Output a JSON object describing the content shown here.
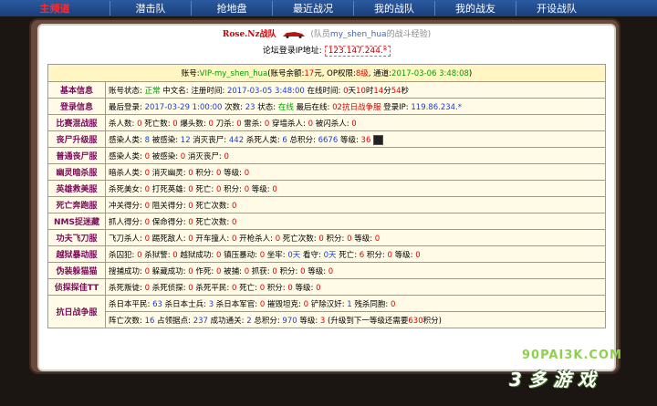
{
  "nav": {
    "brand": "主频道",
    "items": [
      "潜击队",
      "抢地盘",
      "最近战况",
      "我的战队",
      "我的战友",
      "开设战队"
    ]
  },
  "header": {
    "team_name": "Rose.Nz",
    "team_suffix": "战队",
    "member_prefix": "(队员",
    "member_name": "my_shen_hua",
    "member_suffix": "的战斗经验)",
    "forum_ip_label": "论坛登录IP地址:",
    "forum_ip_value": "123.147.244.*"
  },
  "account": {
    "label_account": "账号:",
    "account": "VIP-my_shen_hua",
    "label_balance": "(账号余额:",
    "balance": "17",
    "balance_unit": "元",
    "label_op": ", OP权限:",
    "op": "8级",
    "label_channel": ", 通道:",
    "channel": "2017-03-06 3:48:08",
    "close": ")"
  },
  "rows": [
    {
      "label": "基本信息",
      "parts": [
        {
          "t": "账号状态: "
        },
        {
          "t": "正常",
          "c": "v-green"
        },
        {
          "t": " 中文名:  注册时间: "
        },
        {
          "t": "2017-03-05 3:48:00",
          "c": "v-blue"
        },
        {
          "t": " 在线时间: "
        },
        {
          "t": "0",
          "c": "v-red"
        },
        {
          "t": "天"
        },
        {
          "t": "10",
          "c": "v-red"
        },
        {
          "t": "时"
        },
        {
          "t": "14",
          "c": "v-red"
        },
        {
          "t": "分"
        },
        {
          "t": "54",
          "c": "v-red"
        },
        {
          "t": "秒"
        }
      ]
    },
    {
      "label": "登录信息",
      "parts": [
        {
          "t": "最后登录: "
        },
        {
          "t": "2017-03-29 1:00:00",
          "c": "v-blue"
        },
        {
          "t": " 次数: "
        },
        {
          "t": "23",
          "c": "v-blue"
        },
        {
          "t": " 状态: "
        },
        {
          "t": "在线",
          "c": "v-green"
        },
        {
          "t": " 最后在线: "
        },
        {
          "t": "02抗日战争服",
          "c": "v-red"
        },
        {
          "t": " 登录IP: "
        },
        {
          "t": "119.86.234.*",
          "c": "v-blue"
        }
      ]
    },
    {
      "label": "比赛混战服",
      "parts": [
        {
          "t": "杀人数: "
        },
        {
          "t": "0",
          "c": "v-red"
        },
        {
          "t": " 死亡数: "
        },
        {
          "t": "0",
          "c": "v-red"
        },
        {
          "t": " 爆头数: "
        },
        {
          "t": "0",
          "c": "v-red"
        },
        {
          "t": " 刀杀: "
        },
        {
          "t": "0",
          "c": "v-red"
        },
        {
          "t": " 雷杀: "
        },
        {
          "t": "0",
          "c": "v-red"
        },
        {
          "t": " 穿墙杀人: "
        },
        {
          "t": "0",
          "c": "v-red"
        },
        {
          "t": " 被闪杀人: "
        },
        {
          "t": "0",
          "c": "v-red"
        }
      ]
    },
    {
      "label": "丧尸升级服",
      "icon": true,
      "parts": [
        {
          "t": "感染人类: "
        },
        {
          "t": "8",
          "c": "v-blue"
        },
        {
          "t": " 被感染: "
        },
        {
          "t": "12",
          "c": "v-blue"
        },
        {
          "t": " 消灭丧尸: "
        },
        {
          "t": "442",
          "c": "v-blue"
        },
        {
          "t": " 杀死人类: "
        },
        {
          "t": "6",
          "c": "v-blue"
        },
        {
          "t": " 总积分: "
        },
        {
          "t": "6676",
          "c": "v-blue"
        },
        {
          "t": " 等级: "
        },
        {
          "t": "36",
          "c": "v-red"
        },
        {
          "t": " "
        }
      ]
    },
    {
      "label": "普通丧尸服",
      "parts": [
        {
          "t": "感染人类: "
        },
        {
          "t": "0",
          "c": "v-red"
        },
        {
          "t": " 被感染: "
        },
        {
          "t": "0",
          "c": "v-red"
        },
        {
          "t": " 消灭丧尸: "
        },
        {
          "t": "0",
          "c": "v-red"
        }
      ]
    },
    {
      "label": "幽灵暗杀服",
      "parts": [
        {
          "t": "暗杀人类: "
        },
        {
          "t": "0",
          "c": "v-red"
        },
        {
          "t": " 消灭幽灵: "
        },
        {
          "t": "0",
          "c": "v-red"
        },
        {
          "t": " 积分: "
        },
        {
          "t": "0",
          "c": "v-red"
        },
        {
          "t": " 等级: "
        },
        {
          "t": "0",
          "c": "v-red"
        }
      ]
    },
    {
      "label": "英雄救美服",
      "parts": [
        {
          "t": "杀死美女: "
        },
        {
          "t": "0",
          "c": "v-red"
        },
        {
          "t": " 打死英雄: "
        },
        {
          "t": "0",
          "c": "v-red"
        },
        {
          "t": " 死亡: "
        },
        {
          "t": "0",
          "c": "v-red"
        },
        {
          "t": " 积分: "
        },
        {
          "t": "0",
          "c": "v-red"
        },
        {
          "t": " 等级: "
        },
        {
          "t": "0",
          "c": "v-red"
        }
      ]
    },
    {
      "label": "死亡奔跑服",
      "parts": [
        {
          "t": "冲关得分: "
        },
        {
          "t": "0",
          "c": "v-red"
        },
        {
          "t": " 阻关得分: "
        },
        {
          "t": "0",
          "c": "v-red"
        },
        {
          "t": " 死亡次数: "
        },
        {
          "t": "0",
          "c": "v-red"
        }
      ]
    },
    {
      "label": "NMS捉迷藏",
      "parts": [
        {
          "t": "抓人得分: "
        },
        {
          "t": "0",
          "c": "v-red"
        },
        {
          "t": " 保命得分: "
        },
        {
          "t": "0",
          "c": "v-red"
        },
        {
          "t": " 死亡次数: "
        },
        {
          "t": "0",
          "c": "v-red"
        }
      ]
    },
    {
      "label": "功夫飞刀服",
      "parts": [
        {
          "t": "飞刀杀人: "
        },
        {
          "t": "0",
          "c": "v-red"
        },
        {
          "t": " 踢死敌人: "
        },
        {
          "t": "0",
          "c": "v-red"
        },
        {
          "t": " 开车撞人: "
        },
        {
          "t": "0",
          "c": "v-red"
        },
        {
          "t": " 开枪杀人: "
        },
        {
          "t": "0",
          "c": "v-red"
        },
        {
          "t": " 死亡次数: "
        },
        {
          "t": "0",
          "c": "v-red"
        },
        {
          "t": " 积分: "
        },
        {
          "t": "0",
          "c": "v-red"
        },
        {
          "t": " 等级: "
        },
        {
          "t": "0",
          "c": "v-red"
        }
      ]
    },
    {
      "label": "越狱暴动服",
      "parts": [
        {
          "t": "杀囚犯: "
        },
        {
          "t": "0",
          "c": "v-red"
        },
        {
          "t": " 杀狱警: "
        },
        {
          "t": "0",
          "c": "v-red"
        },
        {
          "t": " 越狱成功: "
        },
        {
          "t": "0",
          "c": "v-red"
        },
        {
          "t": " 镇压暴动: "
        },
        {
          "t": "0",
          "c": "v-red"
        },
        {
          "t": " 坐牢: "
        },
        {
          "t": "0天",
          "c": "v-blue"
        },
        {
          "t": " 看守: "
        },
        {
          "t": "0天",
          "c": "v-blue"
        },
        {
          "t": " 死亡: "
        },
        {
          "t": "6",
          "c": "v-red"
        },
        {
          "t": " 积分: "
        },
        {
          "t": "0",
          "c": "v-red"
        },
        {
          "t": " 等级: "
        },
        {
          "t": "0",
          "c": "v-red"
        }
      ]
    },
    {
      "label": "伪装躲猫猫",
      "parts": [
        {
          "t": "搜捕成功: "
        },
        {
          "t": "0",
          "c": "v-red"
        },
        {
          "t": " 躲藏成功: "
        },
        {
          "t": "0",
          "c": "v-red"
        },
        {
          "t": " 作死: "
        },
        {
          "t": "0",
          "c": "v-red"
        },
        {
          "t": " 被捕: "
        },
        {
          "t": "0",
          "c": "v-red"
        },
        {
          "t": " 抓获: "
        },
        {
          "t": "0",
          "c": "v-red"
        },
        {
          "t": " 积分: "
        },
        {
          "t": "0",
          "c": "v-red"
        },
        {
          "t": " 等级: "
        },
        {
          "t": "0",
          "c": "v-red"
        }
      ]
    },
    {
      "label": "侦探探佳TT",
      "parts": [
        {
          "t": "杀死叛徒: "
        },
        {
          "t": "0",
          "c": "v-red"
        },
        {
          "t": " 杀死侦探: "
        },
        {
          "t": "0",
          "c": "v-red"
        },
        {
          "t": " 杀死平民: "
        },
        {
          "t": "0",
          "c": "v-red"
        },
        {
          "t": " 死亡: "
        },
        {
          "t": "0",
          "c": "v-red"
        },
        {
          "t": " 积分: "
        },
        {
          "t": "0",
          "c": "v-red"
        },
        {
          "t": " 等级: "
        },
        {
          "t": "0",
          "c": "v-red"
        }
      ]
    }
  ],
  "war": {
    "label": "抗日战争服",
    "line1": [
      {
        "t": "杀日本平民: "
      },
      {
        "t": "63",
        "c": "v-blue"
      },
      {
        "t": " 杀日本士兵: "
      },
      {
        "t": "3",
        "c": "v-blue"
      },
      {
        "t": " 杀日本军官: "
      },
      {
        "t": "0",
        "c": "v-red"
      },
      {
        "t": " 摧毁坦克: "
      },
      {
        "t": "0",
        "c": "v-red"
      },
      {
        "t": " 铲除汉奸: "
      },
      {
        "t": "1",
        "c": "v-blue"
      },
      {
        "t": " 残杀同胞: "
      },
      {
        "t": "0",
        "c": "v-red"
      }
    ],
    "line2": [
      {
        "t": "阵亡次数: "
      },
      {
        "t": "16",
        "c": "v-blue"
      },
      {
        "t": " 占领据点: "
      },
      {
        "t": "237",
        "c": "v-blue"
      },
      {
        "t": " 成功通关: "
      },
      {
        "t": "2",
        "c": "v-blue"
      },
      {
        "t": " 总积分: "
      },
      {
        "t": "970",
        "c": "v-blue"
      },
      {
        "t": " 等级: "
      },
      {
        "t": "3",
        "c": "v-red"
      },
      {
        "t": " (升级到下一等级还需要"
      },
      {
        "t": "630",
        "c": "v-red"
      },
      {
        "t": "积分)"
      }
    ]
  },
  "watermark": {
    "top": "90PAI3K.COM",
    "big": "3 多 游 戏"
  }
}
